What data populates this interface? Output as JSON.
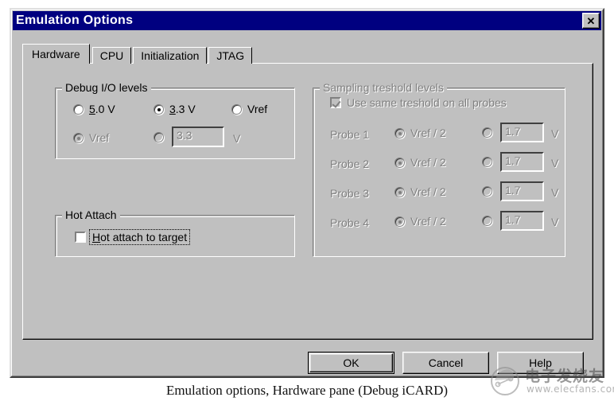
{
  "window": {
    "title": "Emulation Options",
    "close_button": "✕",
    "close_icon_name": "close-icon"
  },
  "tabs": [
    {
      "label": "Hardware",
      "selected": true
    },
    {
      "label": "CPU",
      "selected": false
    },
    {
      "label": "Initialization",
      "selected": false
    },
    {
      "label": "JTAG",
      "selected": false
    }
  ],
  "debug_io": {
    "title": "Debug I/O levels",
    "title_accel": "g",
    "row1": [
      {
        "label_pre": "",
        "accel": "5",
        "label_post": ".0 V",
        "checked": false,
        "disabled": false
      },
      {
        "label_pre": "",
        "accel": "3",
        "label_post": ".3 V",
        "checked": true,
        "disabled": false
      },
      {
        "label_pre": "Vref",
        "accel": "",
        "label_post": "",
        "checked": false,
        "disabled": false
      }
    ],
    "row2": {
      "vref_label": "Vref",
      "vref_checked": true,
      "custom_checked": false,
      "value": "3.3",
      "unit": "V"
    }
  },
  "hot_attach": {
    "title": "Hot Attach",
    "checkbox": {
      "accel": "H",
      "label_post": "ot attach to target",
      "checked": false,
      "focused": true
    }
  },
  "sampling": {
    "title": "Sampling treshold levels",
    "same_threshold": {
      "label": "Use same treshold on all probes",
      "checked": true,
      "disabled": true
    },
    "probes": [
      {
        "name": "Probe 1",
        "vref_label": "Vref / 2",
        "vref_checked": true,
        "custom_checked": false,
        "value": "1.7",
        "unit": "V"
      },
      {
        "name": "Probe 2",
        "vref_label": "Vref / 2",
        "vref_checked": true,
        "custom_checked": false,
        "value": "1.7",
        "unit": "V"
      },
      {
        "name": "Probe 3",
        "vref_label": "Vref / 2",
        "vref_checked": true,
        "custom_checked": false,
        "value": "1.7",
        "unit": "V"
      },
      {
        "name": "Probe 4",
        "vref_label": "Vref / 2",
        "vref_checked": true,
        "custom_checked": false,
        "value": "1.7",
        "unit": "V"
      }
    ]
  },
  "buttons": {
    "ok": "OK",
    "cancel": "Cancel",
    "help": "Help"
  },
  "caption": "Emulation options, Hardware pane (Debug iCARD)",
  "watermark": {
    "cn_text": "电子发烧友",
    "url": "www.elecfans.com"
  },
  "colors": {
    "titlebar": "#000080",
    "face": "#c0c0c0",
    "shadow": "#808080",
    "highlight": "#ffffff",
    "dark": "#404040",
    "text": "#000000",
    "disabled_text": "#808080"
  }
}
